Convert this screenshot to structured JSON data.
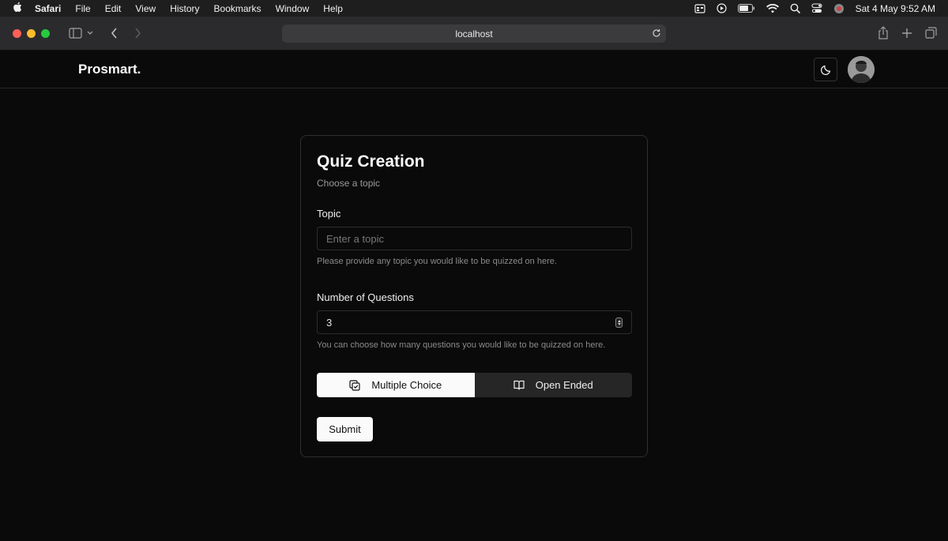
{
  "menubar": {
    "items": [
      "Safari",
      "File",
      "Edit",
      "View",
      "History",
      "Bookmarks",
      "Window",
      "Help"
    ],
    "datetime": "Sat 4 May  9:52 AM"
  },
  "browser": {
    "url": "localhost"
  },
  "nav": {
    "brand": "Prosmart."
  },
  "card": {
    "title": "Quiz Creation",
    "subtitle": "Choose a topic",
    "topic": {
      "label": "Topic",
      "placeholder": "Enter a topic",
      "hint": "Please provide any topic you would like to be quizzed on here."
    },
    "questions": {
      "label": "Number of Questions",
      "value": "3",
      "hint": "You can choose how many questions you would like to be quizzed on here."
    },
    "type_toggle": {
      "options": [
        "Multiple Choice",
        "Open Ended"
      ],
      "selected": "Multiple Choice"
    },
    "submit_label": "Submit"
  }
}
